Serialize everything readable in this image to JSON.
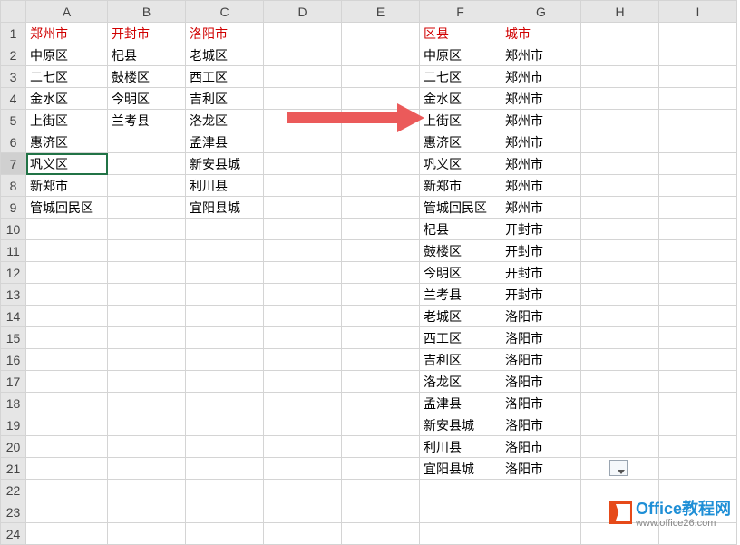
{
  "columns": [
    "A",
    "B",
    "C",
    "D",
    "E",
    "F",
    "G",
    "H",
    "I"
  ],
  "rows": [
    "1",
    "2",
    "3",
    "4",
    "5",
    "6",
    "7",
    "8",
    "9",
    "10",
    "11",
    "12",
    "13",
    "14",
    "15",
    "16",
    "17",
    "18",
    "19",
    "20",
    "21",
    "22",
    "23",
    "24"
  ],
  "selected_row": 7,
  "selected_cell": "A7",
  "grid": {
    "1": {
      "A": "郑州市",
      "B": "开封市",
      "C": "洛阳市",
      "F": "区县",
      "G": "城市"
    },
    "2": {
      "A": "中原区",
      "B": "杞县",
      "C": "老城区",
      "F": "中原区",
      "G": "郑州市"
    },
    "3": {
      "A": "二七区",
      "B": "鼓楼区",
      "C": "西工区",
      "F": "二七区",
      "G": "郑州市"
    },
    "4": {
      "A": "金水区",
      "B": "今明区",
      "C": "吉利区",
      "F": "金水区",
      "G": "郑州市"
    },
    "5": {
      "A": "上街区",
      "B": "兰考县",
      "C": "洛龙区",
      "F": "上街区",
      "G": "郑州市"
    },
    "6": {
      "A": "惠济区",
      "C": "孟津县",
      "F": "惠济区",
      "G": "郑州市"
    },
    "7": {
      "A": "巩义区",
      "C": "新安县城",
      "F": "巩义区",
      "G": "郑州市"
    },
    "8": {
      "A": "新郑市",
      "C": "利川县",
      "F": "新郑市",
      "G": "郑州市"
    },
    "9": {
      "A": "管城回民区",
      "C": "宜阳县城",
      "F": "管城回民区",
      "G": "郑州市"
    },
    "10": {
      "F": "杞县",
      "G": "开封市"
    },
    "11": {
      "F": "鼓楼区",
      "G": "开封市"
    },
    "12": {
      "F": "今明区",
      "G": "开封市"
    },
    "13": {
      "F": "兰考县",
      "G": "开封市"
    },
    "14": {
      "F": "老城区",
      "G": "洛阳市"
    },
    "15": {
      "F": "西工区",
      "G": "洛阳市"
    },
    "16": {
      "F": "吉利区",
      "G": "洛阳市"
    },
    "17": {
      "F": "洛龙区",
      "G": "洛阳市"
    },
    "18": {
      "F": "孟津县",
      "G": "洛阳市"
    },
    "19": {
      "F": "新安县城",
      "G": "洛阳市"
    },
    "20": {
      "F": "利川县",
      "G": "洛阳市"
    },
    "21": {
      "F": "宜阳县城",
      "G": "洛阳市"
    }
  },
  "header_cells": [
    "A1",
    "B1",
    "C1",
    "F1",
    "G1"
  ],
  "watermark": {
    "title": "Office教程网",
    "url": "www.office26.com"
  }
}
